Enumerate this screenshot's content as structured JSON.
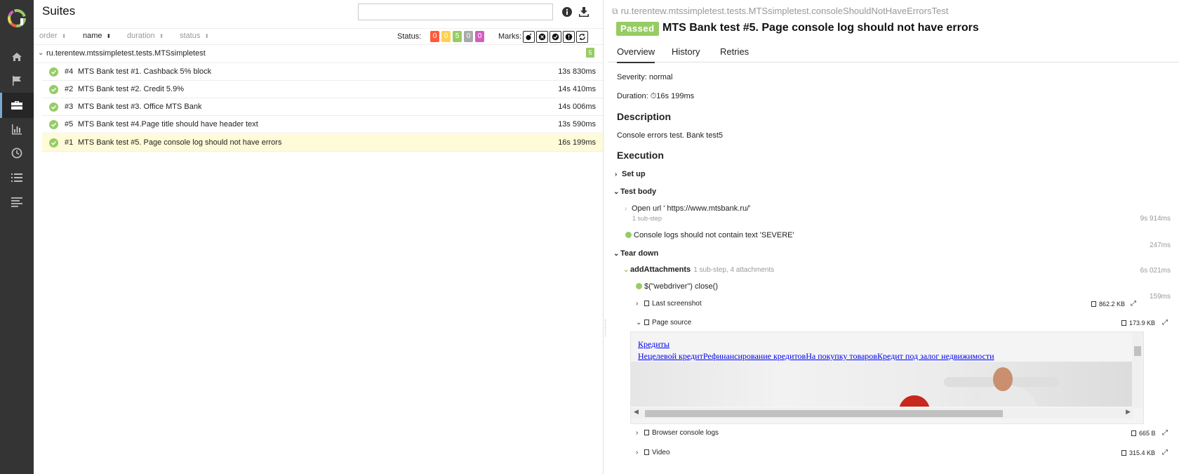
{
  "nav": {
    "items": [
      {
        "name": "home-icon"
      },
      {
        "name": "flag-icon"
      },
      {
        "name": "briefcase-icon"
      },
      {
        "name": "bar-chart-icon"
      },
      {
        "name": "clock-icon"
      },
      {
        "name": "list-icon"
      },
      {
        "name": "lines-icon"
      }
    ],
    "active_index": 2
  },
  "suites": {
    "title": "Suites",
    "search_value": "",
    "sort": {
      "order": "order",
      "name": "name",
      "duration": "duration",
      "status": "status"
    },
    "status_label": "Status:",
    "status_counts": [
      {
        "value": "0",
        "color": "#fd5a3e"
      },
      {
        "value": "0",
        "color": "#ffd050"
      },
      {
        "value": "5",
        "color": "#97cc64"
      },
      {
        "value": "0",
        "color": "#aaaaaa"
      },
      {
        "value": "0",
        "color": "#d35ebe"
      }
    ],
    "marks_label": "Marks:",
    "group": {
      "name": "ru.terentew.mtssimpletest.tests.MTSsimpletest",
      "count": "5"
    },
    "tests": [
      {
        "id": "#4",
        "name": "MTS Bank test #1. Cashback 5% block",
        "duration": "13s 830ms"
      },
      {
        "id": "#2",
        "name": "MTS Bank test #2. Credit 5.9%",
        "duration": "14s 410ms"
      },
      {
        "id": "#3",
        "name": "MTS Bank test #3. Office MTS Bank",
        "duration": "14s 006ms"
      },
      {
        "id": "#5",
        "name": "MTS Bank test #4.Page title should have header text",
        "duration": "13s 590ms"
      },
      {
        "id": "#1",
        "name": "MTS Bank test #5. Page console log should not have errors",
        "duration": "16s 199ms"
      }
    ]
  },
  "result": {
    "breadcrumb": "ru.terentew.mtssimpletest.tests.MTSsimpletest.consoleShouldNotHaveErrorsTest",
    "status": "Passed",
    "title": "MTS Bank test #5. Page console log should not have errors",
    "tabs": [
      "Overview",
      "History",
      "Retries"
    ],
    "severity": "Severity: normal",
    "duration_label": "Duration:",
    "duration": "16s 199ms",
    "description_h": "Description",
    "description": "Console errors test. Bank test5",
    "execution_h": "Execution",
    "setup": "Set up",
    "test_body": "Test body",
    "step_open": "Open url ' https://www.mtsbank.ru/'",
    "step_open_sub": "1 sub-step",
    "step_open_dur": "9s 914ms",
    "step_console": "Console logs should not contain text 'SEVERE'",
    "step_console_dur": "247ms",
    "teardown": "Tear down",
    "add_att": "addAttachments",
    "add_att_meta": "1 sub-step, 4 attachments",
    "add_att_dur": "6s 021ms",
    "close_step": "$(\"webdriver\") close()",
    "close_dur": "159ms",
    "attachments": [
      {
        "name": "Last screenshot",
        "size": "862.2 KB"
      },
      {
        "name": "Page source",
        "size": "173.9 KB"
      },
      {
        "name": "Browser console logs",
        "size": "665 B"
      },
      {
        "name": "Video",
        "size": "315.4 KB"
      }
    ],
    "preview": {
      "link1": "Кредиты",
      "link2": "Нецелевой кредитРефинансирование кредитовНа покупку товаровКредит под залог недвижимости"
    }
  }
}
